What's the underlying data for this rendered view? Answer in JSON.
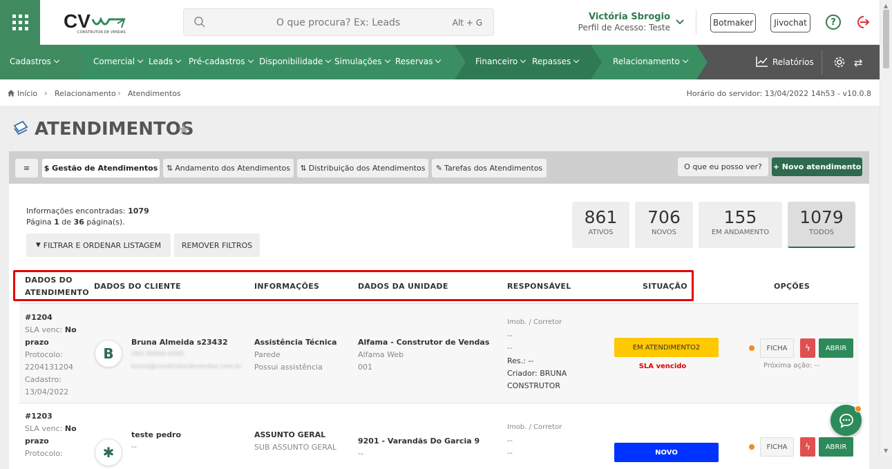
{
  "header": {
    "logo_text": "CV",
    "logo_sub": "CONSTRUTOR DE VENDAS",
    "search_placeholder": "O que procura? Ex: Leads",
    "search_shortcut": "Alt + G",
    "user_name": "Victória Sbrogio",
    "user_profile": "Perfil de Acesso: Teste",
    "botmaker": "Botmaker",
    "jivochat": "Jivochat",
    "help": "?"
  },
  "nav": {
    "cadastros": "Cadastros",
    "comercial": "Comercial",
    "leads": "Leads",
    "pre_cadastros": "Pré-cadastros",
    "disponibilidade": "Disponibilidade",
    "simulacoes": "Simulações",
    "reservas": "Reservas",
    "financeiro": "Financeiro",
    "repasses": "Repasses",
    "relacionamento": "Relacionamento",
    "relatorios": "Relatórios"
  },
  "breadcrumb": {
    "home": "Início",
    "rel": "Relacionamento",
    "atend": "Atendimentos",
    "server_time": "Horário do servidor: 13/04/2022 14h53 - v10.0.8"
  },
  "page": {
    "title": "ATENDIMENTOS"
  },
  "tabs": {
    "menu": "≡",
    "gestao": "$ Gestão de Atendimentos",
    "andamento": "Andamento dos Atendimentos",
    "distribuicao": "Distribuição dos Atendimentos",
    "tarefas": "Tarefas dos Atendimentos",
    "what_see": "O que eu posso ver?",
    "novo": "+ Novo atendimento"
  },
  "summary": {
    "found_label": "Informações encontradas:",
    "found_value": "1079",
    "page_label_a": "Página",
    "page_num": "1",
    "page_label_b": "de",
    "page_total": "36",
    "page_label_c": "página(s).",
    "filter": "FILTRAR E ORDENAR LISTAGEM",
    "remove": "REMOVER FILTROS"
  },
  "stats": [
    {
      "num": "861",
      "label": "ATIVOS"
    },
    {
      "num": "706",
      "label": "NOVOS"
    },
    {
      "num": "155",
      "label": "EM ANDAMENTO"
    },
    {
      "num": "1079",
      "label": "TODOS"
    }
  ],
  "columns": {
    "dados_atend_1": "DADOS DO",
    "dados_atend_2": "ATENDIMENTO",
    "cliente": "DADOS DO CLIENTE",
    "info": "INFORMAÇÕES",
    "unidade": "DADOS DA UNIDADE",
    "resp": "RESPONSÁVEL",
    "situacao": "SITUAÇÃO",
    "opcoes": "OPÇÕES"
  },
  "rows": [
    {
      "id": "#1204",
      "sla_label": "SLA venc:",
      "sla_value_a": "No",
      "sla_value_b": "prazo",
      "protocol_label": "Protocolo:",
      "protocol": "2204131204",
      "cadastro_label": "Cadastro:",
      "cadastro": "13/04/2022",
      "avatar": "B",
      "client": "Bruna Almeida s23432",
      "client_phone": "(00) 00000-0000",
      "client_email": "bruna@construtordevendas.com.br",
      "info_title": "Assistência Técnica",
      "info_sub1": "Parede",
      "info_sub2": "Possui assistência",
      "unit_title": "Alfama - Construtor de Vendas",
      "unit_sub1": "Alfama Web",
      "unit_sub2": "001",
      "resp_label": "Imob. / Corretor",
      "resp_l1": "--",
      "resp_l2": "--",
      "resp_res": "Res.: --",
      "resp_criador": "Criador: BRUNA",
      "resp_criador2": "CONSTRUTOR",
      "status": "EM ATENDIMENTO2",
      "sla_status": "SLA vencido",
      "ficha": "FICHA",
      "abrir": "ABRIR",
      "next_action": "Próxima ação: --"
    },
    {
      "id": "#1203",
      "sla_label": "SLA venc:",
      "sla_value_a": "No",
      "sla_value_b": "prazo",
      "protocol_label": "Protocolo:",
      "client": "teste pedro",
      "client_sub": "--",
      "info_title": "ASSUNTO GERAL",
      "info_sub1": "SUB ASSUNTO GERAL",
      "unit_title": "9201 - Varandãs Do Garcia 9",
      "unit_sub1": "--",
      "resp_label": "Imob. / Corretor",
      "resp_l1": "--",
      "resp_l2": "--",
      "status": "NOVO",
      "ficha": "FICHA",
      "abrir": "ABRIR"
    }
  ]
}
